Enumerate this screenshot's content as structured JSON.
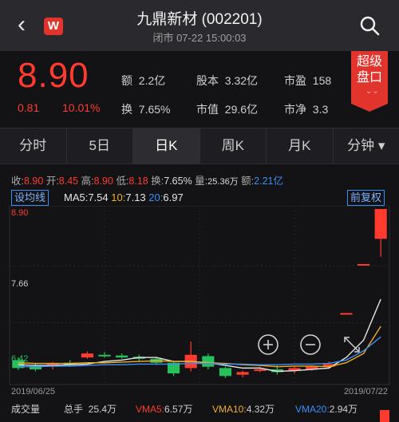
{
  "header": {
    "back_icon": "chevron-left-icon",
    "logo_text": "W",
    "stock_name": "九鼎新材 (002201)",
    "status_line": "闭市 07-22 15:00:03",
    "search_icon": "search-icon"
  },
  "quote": {
    "price": "8.90",
    "change": "0.81",
    "change_pct": "10.01%",
    "amount_label": "额",
    "amount": "2.2亿",
    "share_capital_label": "股本",
    "share_capital": "3.32亿",
    "pe_label": "市盈",
    "pe": "158",
    "turnover_label": "换",
    "turnover": "7.65%",
    "market_cap_label": "市值",
    "market_cap": "29.6亿",
    "pb_label": "市净",
    "pb": "3.3",
    "super_button_line1": "超级",
    "super_button_line2": "盘口",
    "super_chevron": "⌄⌄"
  },
  "tabs": [
    {
      "label": "分时"
    },
    {
      "label": "5日"
    },
    {
      "label": "日K"
    },
    {
      "label": "周K"
    },
    {
      "label": "月K"
    },
    {
      "label": "分钟 ▾"
    }
  ],
  "day_stats": {
    "close_label": "收:",
    "close": "8.90",
    "open_label": "开:",
    "open": "8.45",
    "high_label": "高:",
    "high": "8.90",
    "low_label": "低:",
    "low": "8.18",
    "turnover_label": "换:",
    "turnover": "7.65%",
    "volume_label": "量:",
    "volume": "25.36万",
    "amount_label": "额:",
    "amount": "2.21亿"
  },
  "ma_row": {
    "indicator_button": "设均线",
    "ma5_label": "MA5:",
    "ma5": "7.54",
    "ma10_label": "10:",
    "ma10": "7.13",
    "ma20_label": "20:",
    "ma20": "6.97",
    "adjust_button": "前复权"
  },
  "colors": {
    "up": "#ff3b30",
    "down": "#26c15b",
    "ma5": "#e6e6e6",
    "ma10": "#f0b020",
    "ma20": "#3a8ef6",
    "accent": "#e0342c"
  },
  "chart_data": {
    "type": "candlestick",
    "y_high_label": "8.90",
    "y_mid_label": "7.66",
    "y_low_label": "6.42",
    "x_start_label": "2019/06/25",
    "x_end_label": "2019/07/22",
    "zoom_in_icon": "zoom-in-icon",
    "zoom_out_icon": "zoom-out-icon",
    "expand_icon": "expand-icon",
    "candles": [
      {
        "o": 6.62,
        "c": 6.5,
        "h": 6.66,
        "l": 6.47
      },
      {
        "o": 6.53,
        "c": 6.48,
        "h": 6.57,
        "l": 6.45
      },
      {
        "o": 6.52,
        "c": 6.56,
        "h": 6.59,
        "l": 6.48
      },
      {
        "o": 6.58,
        "c": 6.55,
        "h": 6.62,
        "l": 6.52
      },
      {
        "o": 6.66,
        "c": 6.72,
        "h": 6.75,
        "l": 6.64
      },
      {
        "o": 6.7,
        "c": 6.68,
        "h": 6.74,
        "l": 6.66
      },
      {
        "o": 6.69,
        "c": 6.66,
        "h": 6.72,
        "l": 6.64
      },
      {
        "o": 6.67,
        "c": 6.64,
        "h": 6.7,
        "l": 6.6
      },
      {
        "o": 6.64,
        "c": 6.58,
        "h": 6.67,
        "l": 6.55
      },
      {
        "o": 6.58,
        "c": 6.42,
        "h": 6.6,
        "l": 6.38
      },
      {
        "o": 6.5,
        "c": 6.7,
        "h": 6.9,
        "l": 6.45
      },
      {
        "o": 6.68,
        "c": 6.52,
        "h": 6.72,
        "l": 6.48
      },
      {
        "o": 6.5,
        "c": 6.38,
        "h": 6.52,
        "l": 6.35
      },
      {
        "o": 6.4,
        "c": 6.44,
        "h": 6.46,
        "l": 6.36
      },
      {
        "o": 6.46,
        "c": 6.48,
        "h": 6.52,
        "l": 6.44
      },
      {
        "o": 6.48,
        "c": 6.44,
        "h": 6.54,
        "l": 6.4
      },
      {
        "o": 6.46,
        "c": 6.5,
        "h": 6.52,
        "l": 6.42
      },
      {
        "o": 6.48,
        "c": 6.52,
        "h": 6.54,
        "l": 6.46
      },
      {
        "o": 6.52,
        "c": 6.56,
        "h": 6.6,
        "l": 6.5
      },
      {
        "o": 7.32,
        "c": 7.33,
        "h": 7.33,
        "l": 7.32
      },
      {
        "o": 8.06,
        "c": 8.07,
        "h": 8.07,
        "l": 8.06
      },
      {
        "o": 8.45,
        "c": 8.9,
        "h": 8.9,
        "l": 8.18
      }
    ],
    "ma5": [
      6.55,
      6.54,
      6.54,
      6.55,
      6.56,
      6.6,
      6.62,
      6.66,
      6.66,
      6.6,
      6.6,
      6.58,
      6.54,
      6.5,
      6.5,
      6.45,
      6.46,
      6.48,
      6.5,
      6.66,
      6.92,
      7.54
    ],
    "ma10": [
      6.58,
      6.57,
      6.57,
      6.57,
      6.58,
      6.58,
      6.59,
      6.6,
      6.61,
      6.6,
      6.6,
      6.58,
      6.57,
      6.55,
      6.54,
      6.52,
      6.53,
      6.53,
      6.52,
      6.58,
      6.72,
      7.13
    ],
    "ma20": [
      6.52,
      6.52,
      6.53,
      6.53,
      6.54,
      6.55,
      6.55,
      6.56,
      6.56,
      6.56,
      6.57,
      6.57,
      6.56,
      6.56,
      6.55,
      6.55,
      6.56,
      6.56,
      6.57,
      6.62,
      6.76,
      6.97
    ]
  },
  "footer": {
    "label": "成交量",
    "total_label": "总手",
    "total": "25.4万",
    "vma5_label": "VMA5:",
    "vma5": "6.57万",
    "vma10_label": "VMA10:",
    "vma10": "4.32万",
    "vma20_label": "VMA20:",
    "vma20": "2.94万"
  }
}
